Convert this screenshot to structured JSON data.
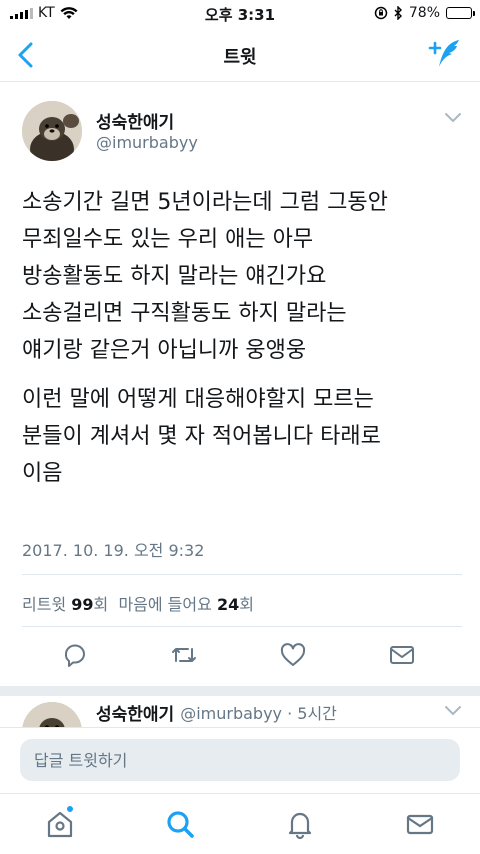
{
  "status_bar": {
    "carrier": "KT",
    "time": "오후 3:31",
    "battery_percent": "78%",
    "battery_level": 0.78
  },
  "nav": {
    "title": "트윗"
  },
  "tweet": {
    "author_name": "성숙한애기",
    "author_handle": "@imurbabyy",
    "paragraphs": [
      [
        "소송기간 길면 5년이라는데 그럼 그동안",
        "무죄일수도 있는 우리 애는 아무",
        "방송활동도 하지 말라는 얘긴가요",
        "소송걸리면 구직활동도 하지 말라는",
        "얘기랑 같은거 아닙니까 웅앵웅"
      ],
      [
        "이런 말에 어떻게 대응해야할지 모르는",
        "분들이 계셔서 몇 자 적어봅니다 타래로",
        "이음"
      ]
    ],
    "timestamp": "2017. 10. 19. 오전 9:32",
    "retweet_label": "리트윗",
    "retweet_count": "99",
    "retweet_unit": "회",
    "like_label": "마음에 들어요",
    "like_count": "24",
    "like_unit": "회"
  },
  "reply_preview": {
    "author_name": "성숙한애기",
    "handle_and_time": "@imurbabyy · 5시간"
  },
  "reply_bar": {
    "placeholder": "답글 트윗하기"
  },
  "colors": {
    "accent": "#1da1f2",
    "text": "#14171a",
    "muted": "#657786",
    "divider": "#e1e8ed"
  },
  "icons": {
    "nav": [
      "back-arrow-icon",
      "compose-tweet-icon"
    ],
    "actions": [
      "reply-icon",
      "retweet-icon",
      "like-icon",
      "direct-message-icon"
    ],
    "tabs": [
      "home-icon",
      "search-icon",
      "notifications-icon",
      "messages-icon"
    ]
  }
}
